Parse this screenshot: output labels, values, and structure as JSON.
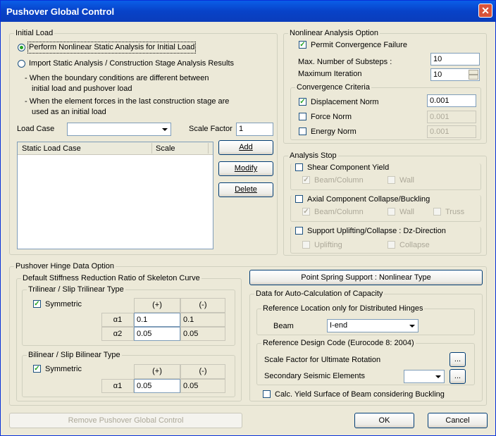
{
  "window": {
    "title": "Pushover Global Control",
    "close": "✕"
  },
  "initial_load": {
    "legend": "Initial Load",
    "radio1": "Perform Nonlinear Static Analysis for Initial Load",
    "radio2": "Import Static Analysis / Construction Stage Analysis Results",
    "note1a": "- When the boundary conditions are different between",
    "note1b": "initial load and pushover load",
    "note2a": "- When the element forces in the last construction stage are",
    "note2b": "used as an initial load",
    "load_case_label": "Load Case",
    "load_case_value": "",
    "scale_factor_label": "Scale Factor",
    "scale_factor_value": "1",
    "columns": [
      "Static Load Case",
      "Scale"
    ],
    "add": "Add",
    "modify": "Modify",
    "delete": "Delete"
  },
  "nonlinear": {
    "legend": "Nonlinear Analysis Option",
    "permit": "Permit Convergence Failure",
    "max_substeps_label": "Max. Number of Substeps :",
    "max_substeps_value": "10",
    "max_iter_label": "Maximum Iteration",
    "max_iter_value": "10",
    "conv_legend": "Convergence Criteria",
    "disp_norm": "Displacement Norm",
    "disp_value": "0.001",
    "force_norm": "Force Norm",
    "force_value": "0.001",
    "energy_norm": "Energy Norm",
    "energy_value": "0.001"
  },
  "analysis_stop": {
    "legend": "Analysis Stop",
    "shear": "Shear Component Yield",
    "shear_beam": "Beam/Column",
    "shear_wall": "Wall",
    "axial": "Axial Component Collapse/Buckling",
    "axial_beam": "Beam/Column",
    "axial_wall": "Wall",
    "axial_truss": "Truss",
    "support": "Support Uplifting/Collapse : Dz-Direction",
    "uplifting": "Uplifting",
    "collapse": "Collapse"
  },
  "hinge": {
    "legend": "Pushover Hinge Data Option",
    "stiff_legend": "Default Stiffness Reduction Ratio of Skeleton Curve",
    "tri_legend": "Trilinear / Slip Trilinear Type",
    "tri_symmetric": "Symmetric",
    "plus": "(+)",
    "minus": "(-)",
    "a1": "α1",
    "a2": "α2",
    "tri_a1_plus": "0.1",
    "tri_a1_minus": "0.1",
    "tri_a2_plus": "0.05",
    "tri_a2_minus": "0.05",
    "bi_legend": "Bilinear / Slip Bilinear Type",
    "bi_symmetric": "Symmetric",
    "bi_a1_plus": "0.05",
    "bi_a1_minus": "0.05",
    "point_spring": "Point Spring Support : Nonlinear Type",
    "auto_legend": "Data for Auto-Calculation of Capacity",
    "ref_loc_legend": "Reference Location only for Distributed Hinges",
    "beam_label": "Beam",
    "beam_value": "I-end",
    "ref_code_legend": "Reference Design Code (Eurocode 8: 2004)",
    "scale_factor_rot": "Scale Factor for Ultimate Rotation",
    "secondary": "Secondary Seismic Elements",
    "secondary_value": "",
    "ellipsis": "...",
    "calc_yield": "Calc. Yield Surface of Beam considering Buckling"
  },
  "footer": {
    "remove": "Remove Pushover Global Control",
    "ok": "OK",
    "cancel": "Cancel"
  }
}
